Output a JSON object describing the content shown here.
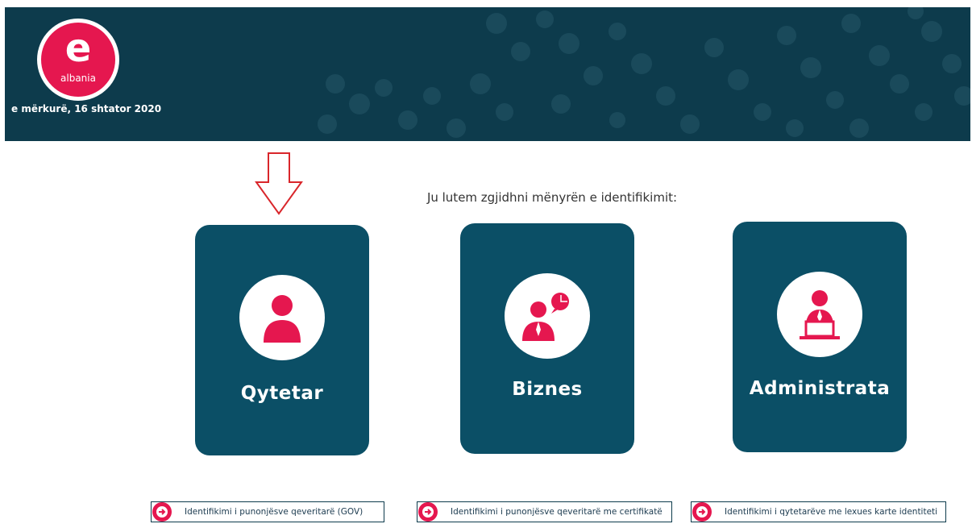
{
  "header": {
    "logo_letter": "e",
    "logo_text": "albania",
    "date": "e mërkurë, 16 shtator 2020"
  },
  "main": {
    "prompt": "Ju lutem zgjidhni mënyrën e identifikimit:",
    "cards": [
      {
        "label": "Qytetar",
        "icon": "citizen-icon"
      },
      {
        "label": "Biznes",
        "icon": "business-icon"
      },
      {
        "label": "Administrata",
        "icon": "administration-icon"
      }
    ]
  },
  "footer_links": [
    {
      "label": "Identifikimi i punonjësve qeveritarë (GOV)",
      "icon": "arrow-circle-icon"
    },
    {
      "label": "Identifikimi i punonjësve qeveritarë me certifikatë",
      "icon": "arrow-circle-icon"
    },
    {
      "label": "Identifikimi i qytetarëve me lexues karte identiteti",
      "icon": "arrow-circle-icon"
    }
  ],
  "colors": {
    "header_bg": "#0d3b4c",
    "card_bg": "#0b4f66",
    "accent": "#e5174f",
    "annotation_arrow": "#d9262b"
  }
}
